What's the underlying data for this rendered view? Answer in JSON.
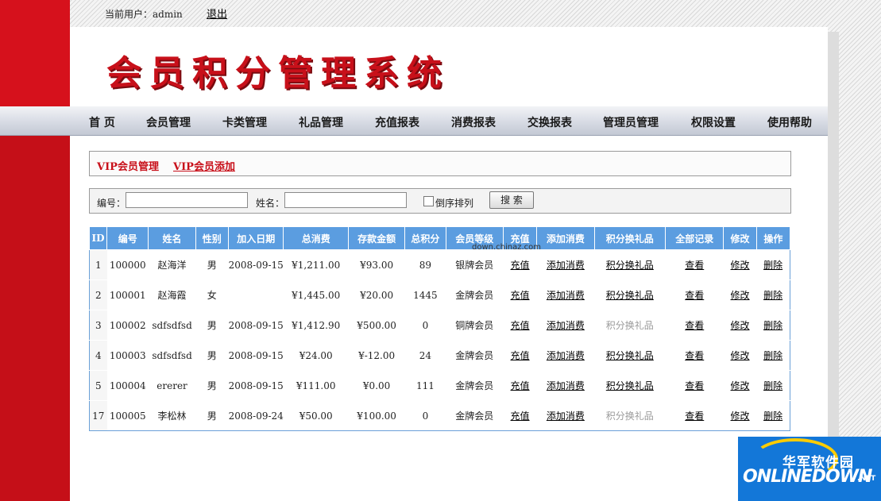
{
  "topbar": {
    "user_label": "当前用户：admin",
    "logout_label": "退出"
  },
  "logo_text": "会员积分管理系统",
  "nav": [
    "首 页",
    "会员管理",
    "卡类管理",
    "礼品管理",
    "充值报表",
    "消费报表",
    "交换报表",
    "管理员管理",
    "权限设置",
    "使用帮助"
  ],
  "tabs": [
    "VIP会员管理",
    "VIP会员添加"
  ],
  "search": {
    "id_label": "编号：",
    "id_value": "",
    "name_label": "姓名：",
    "name_value": "",
    "reverse_label": "倒序排列",
    "button_label": "搜 索"
  },
  "table": {
    "headers": [
      "ID",
      "编号",
      "姓名",
      "性别",
      "加入日期",
      "总消费",
      "存款金额",
      "总积分",
      "会员等级",
      "充值",
      "添加消费",
      "积分换礼品",
      "全部记录",
      "修改",
      "操作"
    ],
    "rows": [
      {
        "id": "1",
        "no": "100000",
        "name": "赵海洋",
        "sex": "男",
        "date": "2008-09-15",
        "total": "¥1,211.00",
        "deposit": "¥93.00",
        "points": "89",
        "level": "银牌会员",
        "recharge": "充值",
        "add": "添加消费",
        "gift": "积分换礼品",
        "gift_enabled": true,
        "view": "查看",
        "edit": "修改",
        "del": "删除"
      },
      {
        "id": "2",
        "no": "100001",
        "name": "赵海霞",
        "sex": "女",
        "date": "",
        "total": "¥1,445.00",
        "deposit": "¥20.00",
        "points": "1445",
        "level": "金牌会员",
        "recharge": "充值",
        "add": "添加消费",
        "gift": "积分换礼品",
        "gift_enabled": true,
        "view": "查看",
        "edit": "修改",
        "del": "删除"
      },
      {
        "id": "3",
        "no": "100002",
        "name": "sdfsdfsd",
        "sex": "男",
        "date": "2008-09-15",
        "total": "¥1,412.90",
        "deposit": "¥500.00",
        "points": "0",
        "level": "铜牌会员",
        "recharge": "充值",
        "add": "添加消费",
        "gift": "积分换礼品",
        "gift_enabled": false,
        "view": "查看",
        "edit": "修改",
        "del": "删除"
      },
      {
        "id": "4",
        "no": "100003",
        "name": "sdfsdfsd",
        "sex": "男",
        "date": "2008-09-15",
        "total": "¥24.00",
        "deposit": "¥-12.00",
        "points": "24",
        "level": "金牌会员",
        "recharge": "充值",
        "add": "添加消费",
        "gift": "积分换礼品",
        "gift_enabled": true,
        "view": "查看",
        "edit": "修改",
        "del": "删除"
      },
      {
        "id": "5",
        "no": "100004",
        "name": "ererer",
        "sex": "男",
        "date": "2008-09-15",
        "total": "¥111.00",
        "deposit": "¥0.00",
        "points": "111",
        "level": "金牌会员",
        "recharge": "充值",
        "add": "添加消费",
        "gift": "积分换礼品",
        "gift_enabled": true,
        "view": "查看",
        "edit": "修改",
        "del": "删除"
      },
      {
        "id": "17",
        "no": "100005",
        "name": "李松林",
        "sex": "男",
        "date": "2008-09-24",
        "total": "¥50.00",
        "deposit": "¥100.00",
        "points": "0",
        "level": "金牌会员",
        "recharge": "充值",
        "add": "添加消费",
        "gift": "积分换礼品",
        "gift_enabled": false,
        "view": "查看",
        "edit": "修改",
        "del": "删除"
      }
    ]
  },
  "watermark_text": "down.chinaz.com",
  "corner_logo": {
    "cn": "华军软件园",
    "en": "ONLINEDOWN",
    "suffix": ".NET"
  },
  "colors": {
    "brand_red": "#d6111c",
    "table_header_blue": "#5b9de0",
    "disabled_link": "#9a9a9a"
  }
}
